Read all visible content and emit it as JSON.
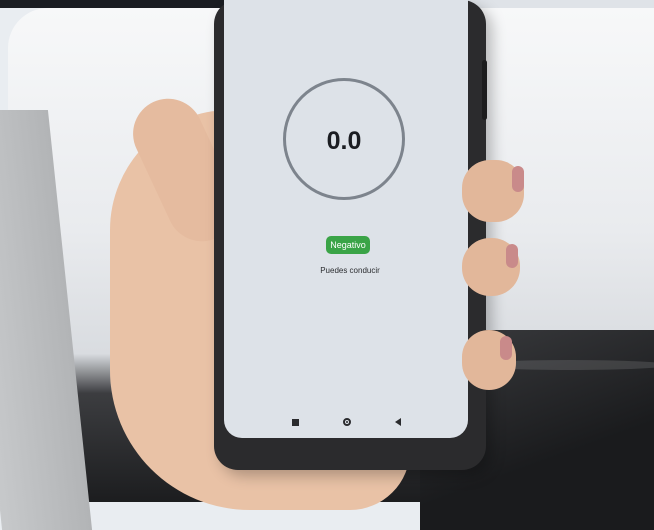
{
  "app": {
    "reading_value": "0.0",
    "result_badge": "Negativo",
    "result_message": "Puedes conducir",
    "colors": {
      "badge_green": "#3aa447",
      "ring_gray": "#7d848d",
      "screen_bg": "#dde2e8"
    }
  },
  "nav_bar": {
    "icons": [
      "recents-square-icon",
      "home-circle-icon",
      "back-triangle-icon"
    ]
  }
}
